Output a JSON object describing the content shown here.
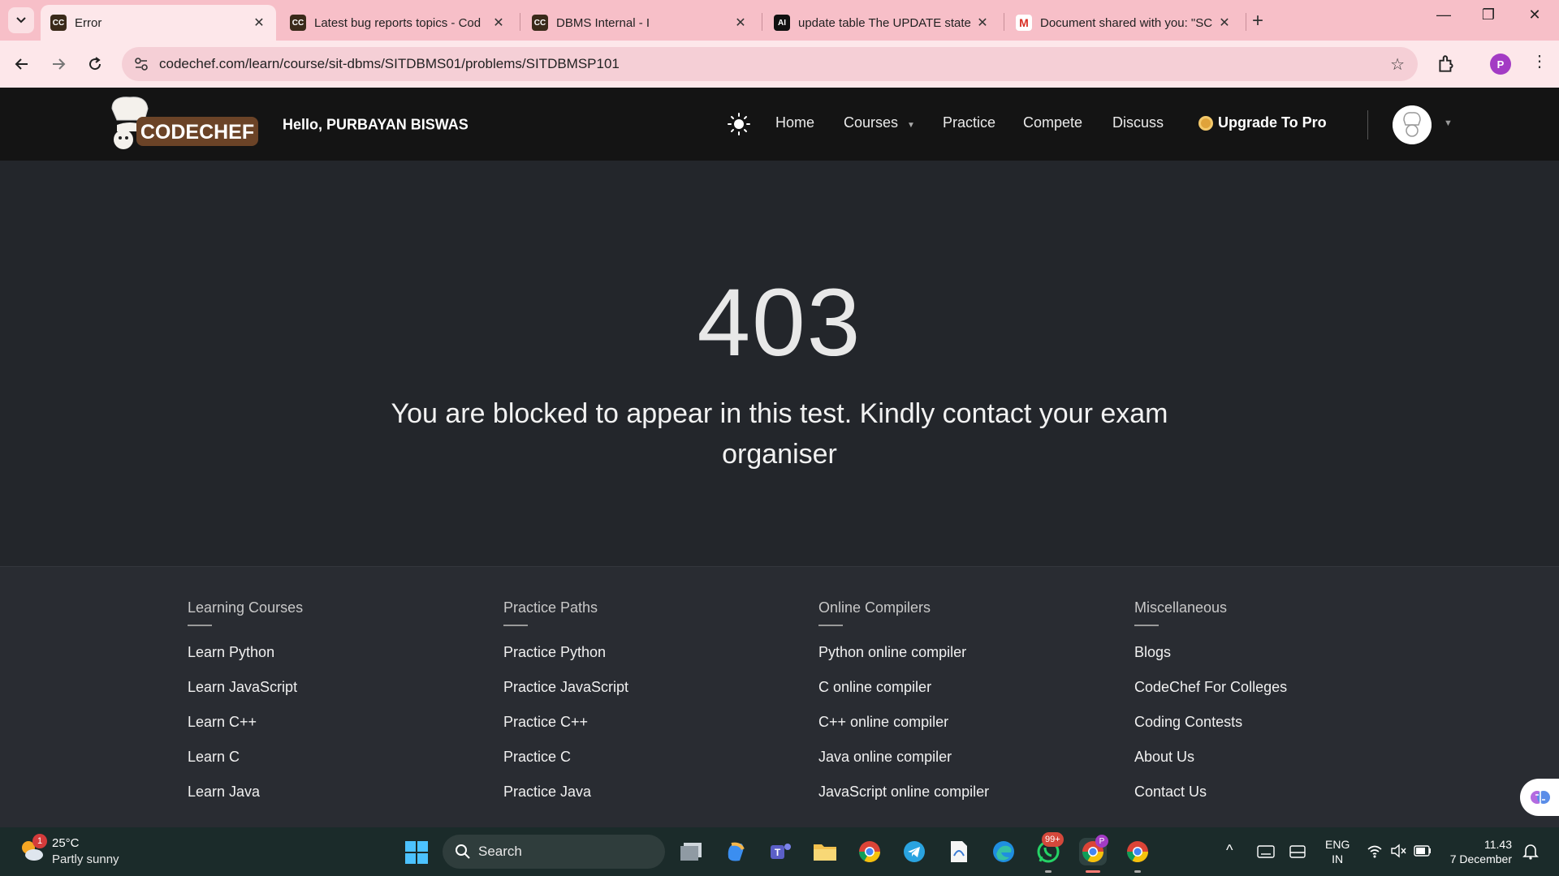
{
  "browser": {
    "tabs": [
      {
        "title": "Error",
        "favicon": "CC"
      },
      {
        "title": "Latest bug reports topics - Cod",
        "favicon": "CC"
      },
      {
        "title": "DBMS Internal - I",
        "favicon": "CC"
      },
      {
        "title": "update table The UPDATE state",
        "favicon": "AI"
      },
      {
        "title": "Document shared with you: \"SC",
        "favicon": "M"
      }
    ],
    "url": "codechef.com/learn/course/sit-dbms/SITDBMS01/problems/SITDBMSP101",
    "profile_initial": "P",
    "colors": {
      "tabstrip": "#f7bfc8",
      "toolbar": "#fde7ea"
    }
  },
  "header": {
    "logo_text": "CODECHEF",
    "greeting": "Hello, PURBAYAN BISWAS",
    "nav": {
      "home": "Home",
      "courses": "Courses",
      "practice": "Practice",
      "compete": "Compete",
      "discuss": "Discuss"
    },
    "upgrade": "Upgrade To Pro"
  },
  "error": {
    "code": "403",
    "message": "You are blocked to appear in this test. Kindly contact your exam organiser"
  },
  "footer": {
    "columns": [
      {
        "heading": "Learning Courses",
        "links": [
          "Learn Python",
          "Learn JavaScript",
          "Learn C++",
          "Learn C",
          "Learn Java"
        ]
      },
      {
        "heading": "Practice Paths",
        "links": [
          "Practice Python",
          "Practice JavaScript",
          "Practice C++",
          "Practice C",
          "Practice Java"
        ]
      },
      {
        "heading": "Online Compilers",
        "links": [
          "Python online compiler",
          "C online compiler",
          "C++ online compiler",
          "Java online compiler",
          "JavaScript online compiler"
        ]
      },
      {
        "heading": "Miscellaneous",
        "links": [
          "Blogs",
          "CodeChef For Colleges",
          "Coding Contests",
          "About Us",
          "Contact Us"
        ]
      }
    ]
  },
  "taskbar": {
    "weather": {
      "temp": "25°C",
      "desc": "Partly sunny",
      "badge": "1"
    },
    "search_label": "Search",
    "whatsapp_badge": "99+",
    "chrome_profile": "P",
    "lang": {
      "line1": "ENG",
      "line2": "IN"
    },
    "clock": {
      "time": "11.43",
      "date": "7 December"
    }
  }
}
